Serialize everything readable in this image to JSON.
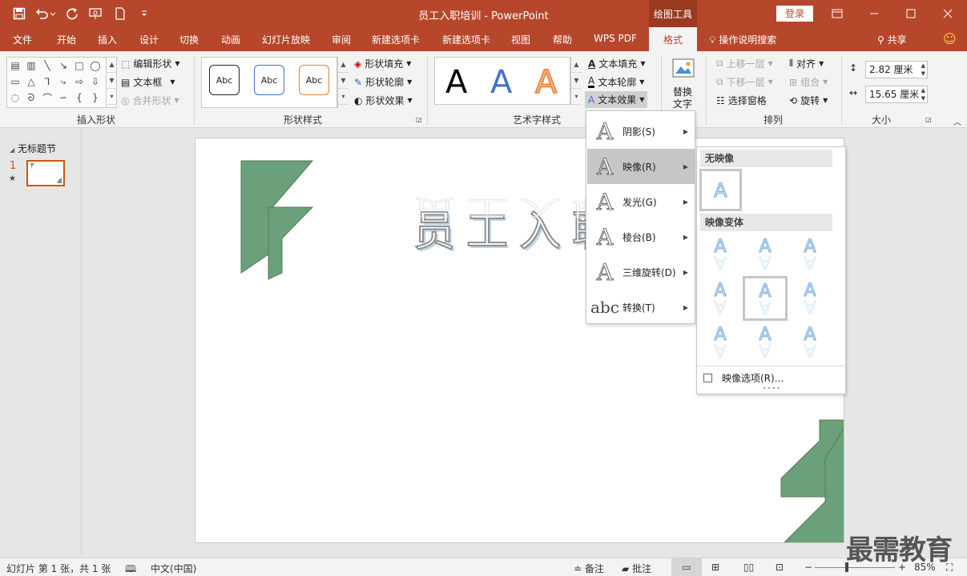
{
  "window": {
    "title": "员工入职培训 - PowerPoint",
    "context_tab": "绘图工具",
    "login": "登录",
    "share": "共享"
  },
  "tabs": [
    "文件",
    "开始",
    "插入",
    "设计",
    "切换",
    "动画",
    "幻灯片放映",
    "审阅",
    "新建选项卡",
    "新建选项卡",
    "视图",
    "帮助",
    "WPS PDF"
  ],
  "active_tab": "格式",
  "tell_me": "操作说明搜索",
  "ribbon": {
    "insert_shapes": {
      "label": "插入形状",
      "edit_shape": "编辑形状",
      "text_box": "文本框",
      "merge_shapes": "合并形状"
    },
    "shape_styles": {
      "label": "形状样式",
      "preview_text": "Abc",
      "fill": "形状填充",
      "outline": "形状轮廓",
      "effects": "形状效果"
    },
    "wordart": {
      "label": "艺术字样式",
      "preview": "A",
      "text_fill": "文本填充",
      "text_outline": "文本轮廓",
      "text_effects": "文本效果"
    },
    "alt_text": {
      "line1": "替换",
      "line2": "文字"
    },
    "arrange": {
      "label": "排列",
      "bring_forward": "上移一层",
      "send_backward": "下移一层",
      "selection_pane": "选择窗格",
      "align": "对齐",
      "group": "组合",
      "rotate": "旋转"
    },
    "size": {
      "label": "大小",
      "height": "2.82 厘米",
      "width": "15.65 厘米"
    }
  },
  "left_pane": {
    "section": "无标题节",
    "slide_number": "1",
    "star": "★"
  },
  "slide": {
    "title_text": "员工入职"
  },
  "text_effects_menu": [
    {
      "label": "阴影(S)",
      "icon": "A"
    },
    {
      "label": "映像(R)",
      "icon": "A"
    },
    {
      "label": "发光(G)",
      "icon": "A"
    },
    {
      "label": "棱台(B)",
      "icon": "A"
    },
    {
      "label": "三维旋转(D)",
      "icon": "A"
    },
    {
      "label": "转换(T)",
      "icon": "abc"
    }
  ],
  "reflection_menu": {
    "no_reflection": "无映像",
    "variants": "映像变体",
    "options": "映像选项(R)...",
    "glyph": "A"
  },
  "status": {
    "slide_info": "幻灯片 第 1 张，共 1 张",
    "language": "中文(中国)",
    "notes": "备注",
    "comments": "批注",
    "zoom": "85%"
  },
  "watermark": "最需教育",
  "colors": {
    "title_bar": "#b7472a",
    "context_tab": "#9a3a20",
    "green_shape": "#6aa07a",
    "accent_blue": "#4472c4",
    "accent_orange": "#ed7d31"
  }
}
